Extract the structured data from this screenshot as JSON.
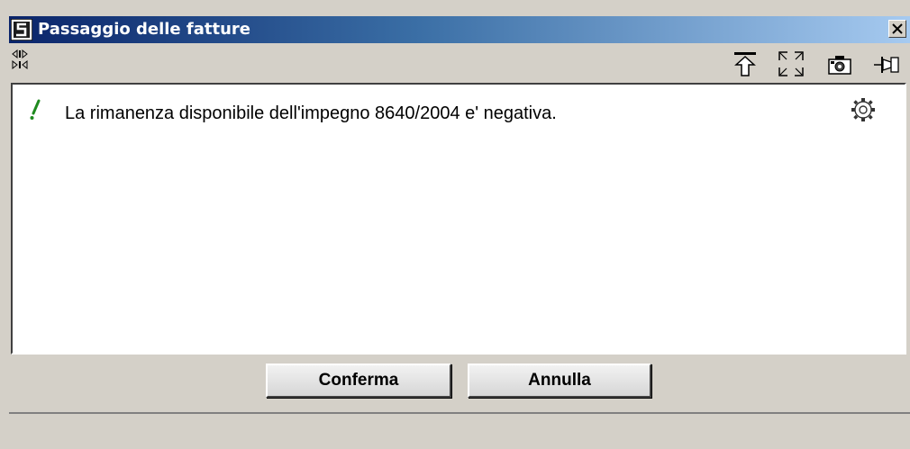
{
  "window": {
    "title": "Passaggio delle fatture"
  },
  "message": {
    "text": "La rimanenza disponibile dell'impegno 8640/2004 e' negativa."
  },
  "buttons": {
    "confirm_label": "Conferma",
    "cancel_label": "Annulla"
  },
  "toolbar": {
    "icons": [
      "arrows-toggle-icon",
      "pin-top-icon",
      "expand-icon",
      "camera-icon",
      "unpin-icon"
    ]
  },
  "colors": {
    "title_gradient_start": "#0a246a",
    "title_gradient_end": "#a6caf0",
    "window_bg": "#d4d0c8",
    "message_mark": "#1f8a1f"
  }
}
